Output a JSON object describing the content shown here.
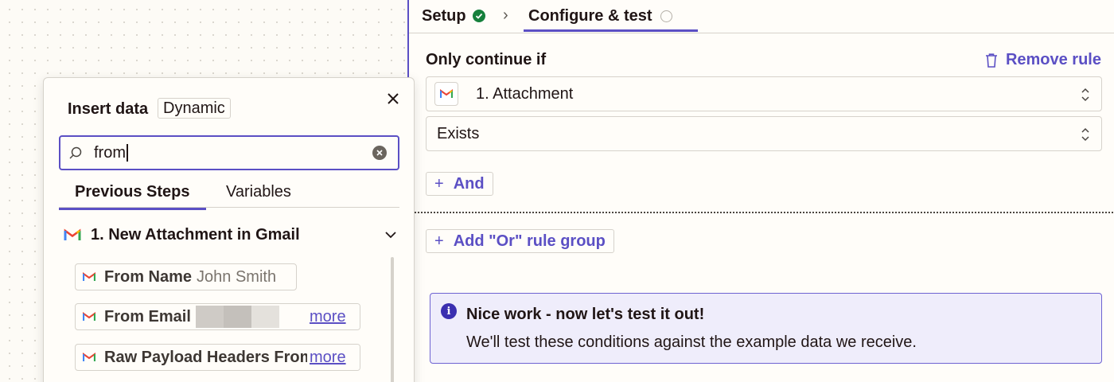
{
  "stepnav": {
    "setup_label": "Setup",
    "configure_label": "Configure & test",
    "separator": "›"
  },
  "rule": {
    "heading": "Only continue if",
    "remove_label": "Remove rule",
    "field_value": "1. Attachment",
    "condition_value": "Exists",
    "and_label": "And",
    "or_label": "Add \"Or\" rule group"
  },
  "info": {
    "title": "Nice work - now let's test it out!",
    "body": "We'll test these conditions against the example data we receive.",
    "icon_char": "i"
  },
  "popover": {
    "title": "Insert data",
    "badge": "Dynamic",
    "search_value": "from",
    "tabs": [
      "Previous Steps",
      "Variables"
    ],
    "group_label": "1.  New Attachment in Gmail",
    "items": [
      {
        "name": "From Name",
        "value": "John Smith"
      },
      {
        "name": "From Email",
        "more": "more"
      },
      {
        "name": "Raw Payload Headers From",
        "more": "more"
      }
    ]
  },
  "colors": {
    "accent": "#5b4fc4",
    "success": "#16803c",
    "info_bg": "#efedfb"
  },
  "icons": [
    "check-icon",
    "pending-circle-icon",
    "trash-icon",
    "gmail-icon",
    "updown-chevron-icon",
    "plus-icon",
    "info-icon",
    "close-icon",
    "search-icon",
    "clear-icon",
    "chevron-down-icon"
  ]
}
